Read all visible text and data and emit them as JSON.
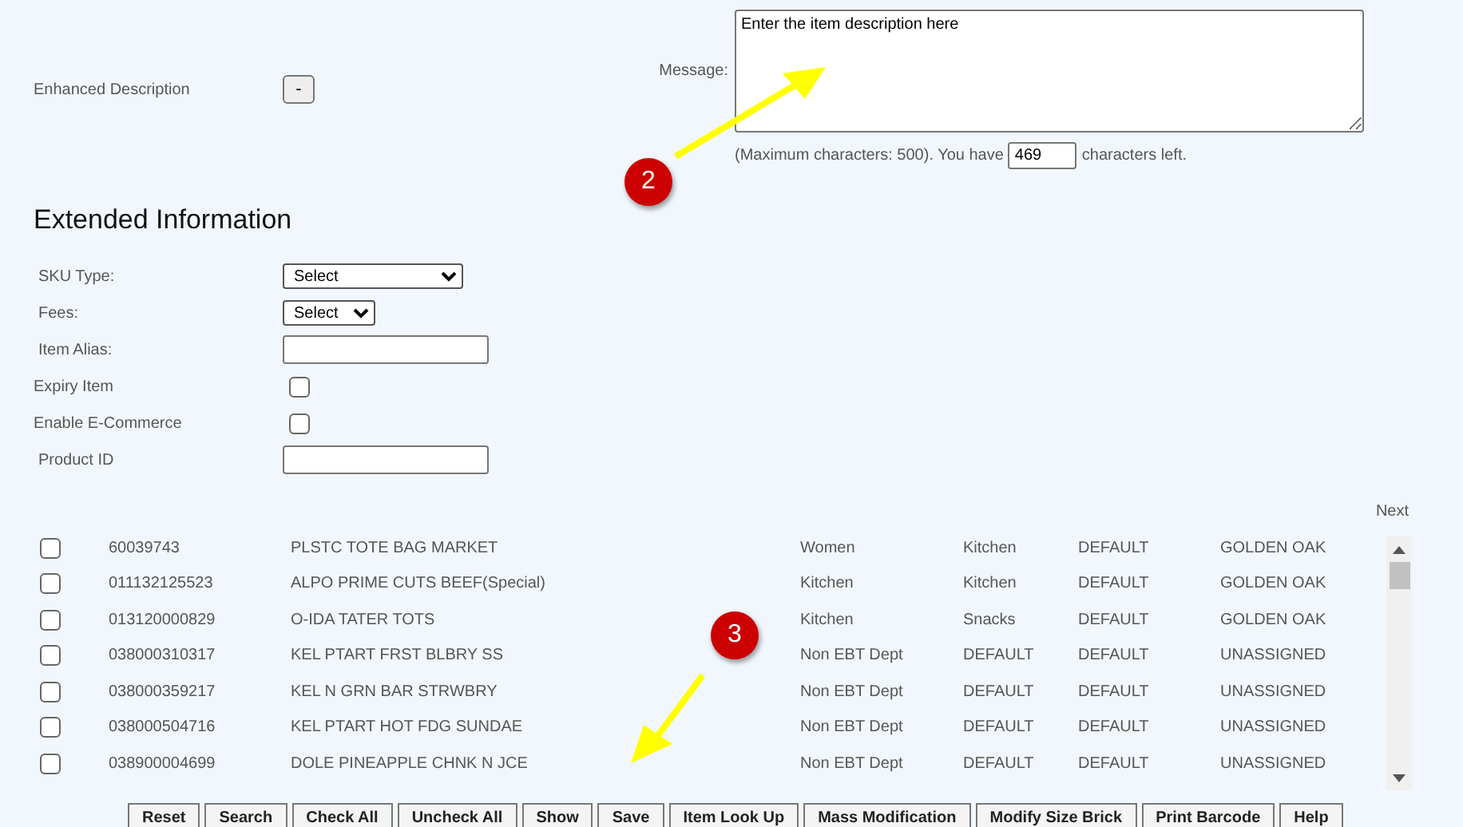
{
  "enhanced_description": {
    "label": "Enhanced Description",
    "button": "-"
  },
  "message": {
    "label": "Message:",
    "value": "Enter the item description here",
    "hint_before": "(Maximum characters: 500). You have",
    "remaining": "469",
    "hint_after": "characters left."
  },
  "extended_information": {
    "title": "Extended Information",
    "fields": [
      {
        "kind": "select",
        "label": "SKU Type:",
        "value": "Select",
        "wide": true
      },
      {
        "kind": "select",
        "label": "Fees:",
        "value": "Select",
        "wide": false
      },
      {
        "kind": "text",
        "label": "Item Alias:"
      },
      {
        "kind": "checkbox",
        "label": "Expiry Item",
        "checked": false
      },
      {
        "kind": "checkbox",
        "label": "Enable E-Commerce",
        "checked": false
      },
      {
        "kind": "text",
        "label": "Product ID"
      }
    ]
  },
  "pager": {
    "next": "Next"
  },
  "table": {
    "rows": [
      {
        "checked": false,
        "code": "60039743",
        "description": "PLSTC TOTE BAG MARKET",
        "department": "Women",
        "category": "Kitchen",
        "size": "DEFAULT",
        "brand": "GOLDEN OAK"
      },
      {
        "checked": false,
        "code": "011132125523",
        "description": "ALPO PRIME CUTS BEEF(Special)",
        "department": "Kitchen",
        "category": "Kitchen",
        "size": "DEFAULT",
        "brand": "GOLDEN OAK"
      },
      {
        "checked": false,
        "code": "013120000829",
        "description": "O-IDA TATER TOTS",
        "department": "Kitchen",
        "category": "Snacks",
        "size": "DEFAULT",
        "brand": "GOLDEN OAK"
      },
      {
        "checked": false,
        "code": "038000310317",
        "description": "KEL PTART FRST BLBRY SS",
        "department": "Non EBT Dept",
        "category": "DEFAULT",
        "size": "DEFAULT",
        "brand": "UNASSIGNED"
      },
      {
        "checked": false,
        "code": "038000359217",
        "description": "KEL N GRN BAR STRWBRY",
        "department": "Non EBT Dept",
        "category": "DEFAULT",
        "size": "DEFAULT",
        "brand": "UNASSIGNED"
      },
      {
        "checked": false,
        "code": "038000504716",
        "description": "KEL PTART HOT FDG SUNDAE",
        "department": "Non EBT Dept",
        "category": "DEFAULT",
        "size": "DEFAULT",
        "brand": "UNASSIGNED"
      },
      {
        "checked": false,
        "code": "038900004699",
        "description": "DOLE PINEAPPLE CHNK N JCE",
        "department": "Non EBT Dept",
        "category": "DEFAULT",
        "size": "DEFAULT",
        "brand": "UNASSIGNED"
      }
    ]
  },
  "buttons": [
    "Reset",
    "Search",
    "Check All",
    "Uncheck All",
    "Show",
    "Save",
    "Item Look Up",
    "Mass Modification",
    "Modify Size Brick",
    "Print Barcode",
    "Help"
  ],
  "annotations": [
    {
      "number": "2"
    },
    {
      "number": "3"
    }
  ]
}
